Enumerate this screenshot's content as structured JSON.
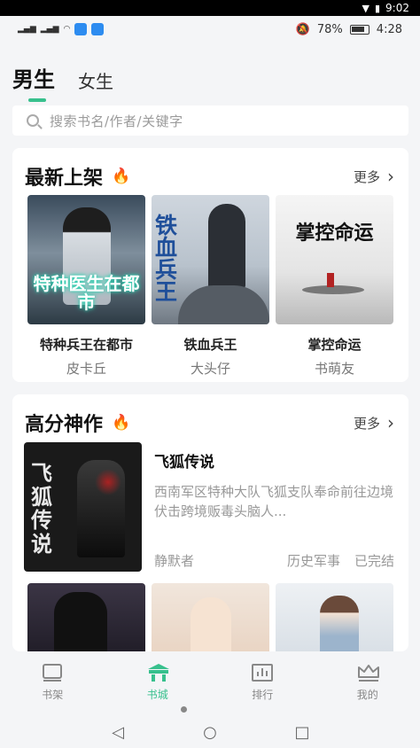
{
  "system": {
    "time": "9:02"
  },
  "status": {
    "battery": "78%",
    "time": "4:28"
  },
  "gender_tabs": [
    {
      "label": "男生",
      "active": true
    },
    {
      "label": "女生",
      "active": false
    }
  ],
  "search": {
    "placeholder": "搜索书名/作者/关键字"
  },
  "new_section": {
    "title": "最新上架",
    "more": "更多",
    "books": [
      {
        "title": "特种兵王在都市",
        "author": "皮卡丘",
        "cover_text": "特种医生在都市"
      },
      {
        "title": "铁血兵王",
        "author": "大头仔",
        "cover_text": "铁血兵王"
      },
      {
        "title": "掌控命运",
        "author": "书萌友",
        "cover_text": "掌控命运"
      }
    ]
  },
  "top_section": {
    "title": "高分神作",
    "more": "更多",
    "featured": {
      "title": "飞狐传说",
      "description": "西南军区特种大队飞狐支队奉命前往边境伏击跨境贩毒头脑人...",
      "author": "静默者",
      "category": "历史军事",
      "status": "已完结",
      "cover_text": "飞狐传说"
    }
  },
  "tabbar": [
    {
      "label": "书架",
      "active": false
    },
    {
      "label": "书城",
      "active": true
    },
    {
      "label": "排行",
      "active": false
    },
    {
      "label": "我的",
      "active": false
    }
  ],
  "colors": {
    "accent": "#37c08d",
    "fire": "#ff6b3d"
  }
}
